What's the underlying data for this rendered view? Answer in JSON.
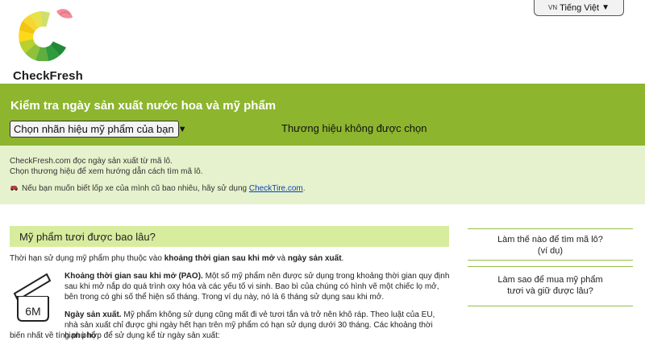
{
  "header": {
    "logo_text": "CheckFresh",
    "lang_code": "VN",
    "lang_label": "Tiếng Việt",
    "lang_arrow": "▼"
  },
  "band": {
    "title": "Kiểm tra ngày sản xuất nước hoa và mỹ phẩm",
    "select_label": "Chọn nhãn hiệu mỹ phẩm của bạn",
    "select_arrow": "▼",
    "status": "Thương hiệu không được chọn"
  },
  "info": {
    "line1": "CheckFresh.com đọc ngày sản xuất từ mã lô.",
    "line2": "Chọn thương hiệu để xem hướng dẫn cách tìm mã lô.",
    "line3_prefix": "Nếu bạn muốn biết lốp xe của mình cũ bao nhiêu, hãy sử dụng ",
    "line3_link": "CheckTire.com",
    "line3_suffix": ".",
    "car_icon": "car-icon"
  },
  "main": {
    "section_title": "Mỹ phẩm tươi được bao lâu?",
    "intro_pre": "Thời hạn sử dụng mỹ phẩm phụ thuộc vào ",
    "intro_b1": "khoảng thời gian sau khi mở",
    "intro_mid": " và ",
    "intro_b2": "ngày sản xuất",
    "intro_end": ".",
    "pao_label": "6M",
    "pao_bold": "Khoảng thời gian sau khi mở (PAO).",
    "pao_text": " Một số mỹ phẩm nên được sử dụng trong khoảng thời gian quy định sau khi mở nắp do quá trình oxy hóa và các yếu tố vi sinh. Bao bì của chúng có hình vẽ một chiếc lọ mở, bên trong có ghi số thể hiện số tháng. Trong ví dụ này, nó là 6 tháng sử dụng sau khi mở.",
    "sale_bold": "Ngày sản xuất.",
    "sale_text1": " Mỹ phẩm không sử dụng cũng mất đi vẻ tươi tắn và trở nên khô ráp. Theo luật của EU, nhà sản xuất chỉ được ghi ngày hết hạn trên mỹ phẩm có hạn sử dụng dưới 30 tháng. Các khoảng thời gian phổ",
    "sale_text2": "biến nhất về tính phù hợp để sử dụng kể từ ngày sản xuất:"
  },
  "sidebar": {
    "card1_line1": "Làm thế nào để tìm mã lô?",
    "card1_line2": "(ví dụ)",
    "card2_line1": "Làm sao để mua mỹ phẩm",
    "card2_line2": "tươi và giữ được lâu?"
  },
  "colors": {
    "brand_green": "#8db52e",
    "info_bg": "#e6f2cd",
    "section_bg": "#d8ec9e",
    "link": "#0b3fb3"
  }
}
